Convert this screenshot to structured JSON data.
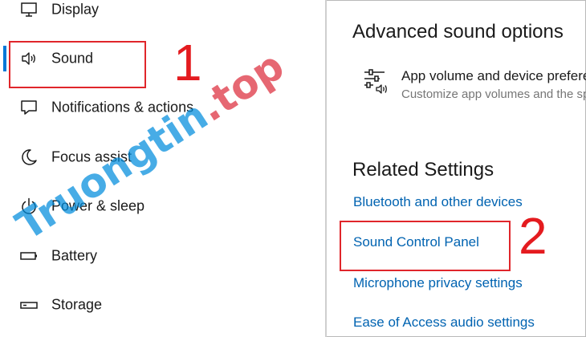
{
  "sidebar": {
    "items": [
      {
        "label": "Display",
        "icon": "display-icon"
      },
      {
        "label": "Sound",
        "icon": "speaker-icon",
        "selected": true
      },
      {
        "label": "Notifications & actions",
        "icon": "notifications-icon"
      },
      {
        "label": "Focus assist",
        "icon": "moon-icon"
      },
      {
        "label": "Power & sleep",
        "icon": "power-icon"
      },
      {
        "label": "Battery",
        "icon": "battery-icon"
      },
      {
        "label": "Storage",
        "icon": "storage-icon"
      }
    ]
  },
  "main": {
    "advanced_title": "Advanced sound options",
    "app_volume": {
      "icon": "sliders-speaker-icon",
      "title": "App volume and device preferences",
      "description": "Customize app volumes and the speakers or devices they use"
    },
    "related_title": "Related Settings",
    "links": [
      "Bluetooth and other devices",
      "Sound Control Panel",
      "Microphone privacy settings",
      "Ease of Access audio settings"
    ]
  },
  "annotations": {
    "marker_1": "1",
    "marker_2": "2",
    "color": "#e41b1f"
  },
  "watermark": {
    "part1": "Truongtin",
    "part2": ".top"
  },
  "colors": {
    "accent": "#0078d7",
    "link": "#0063b1",
    "annotation": "#e41b1f"
  }
}
